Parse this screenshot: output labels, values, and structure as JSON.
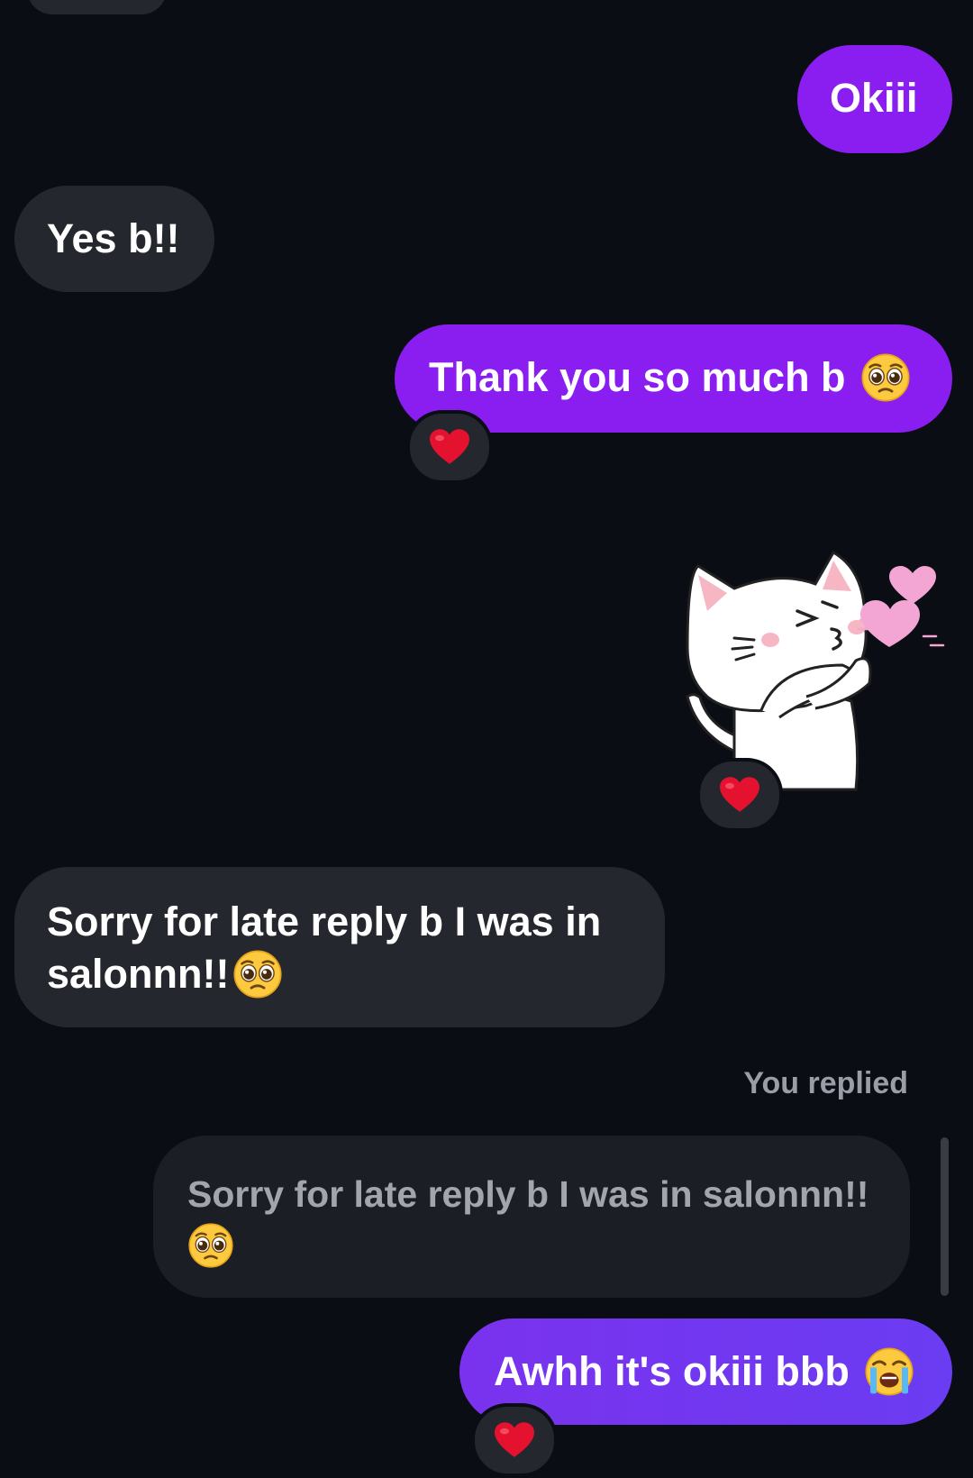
{
  "messages": {
    "okiii": "Okiii",
    "yes_b": "Yes b!!",
    "thank_you": "Thank you so much b",
    "sorry_line1": "Sorry for late reply b I was in",
    "sorry_line2": "salonnn!!",
    "awhh": "Awhh it's okiii bbb"
  },
  "reply": {
    "label": "You replied",
    "quoted_text": "Sorry for late reply b I was in salonnn!!"
  },
  "icons": {
    "reaction": "red-heart-icon",
    "pleading": "pleading-face-emoji",
    "crying": "loudly-crying-face-emoji",
    "sticker": "white-cat-blowing-kiss-sticker"
  },
  "colors": {
    "background": "#0b0d14",
    "incoming_bubble": "#25272e",
    "outgoing_bubble": "#8a1ef0",
    "outgoing_bubble_latest": "#6a3cf2",
    "quoted_bubble": "#1c1e25",
    "heart": "#e4112f"
  }
}
